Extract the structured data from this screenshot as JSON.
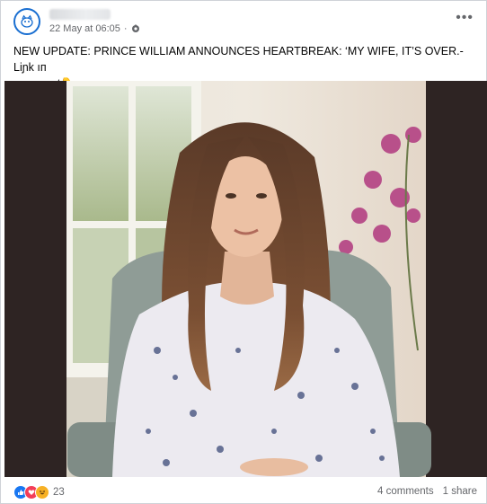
{
  "post": {
    "timestamp": "22 May at 06:05",
    "separator": "·",
    "caption_line1": "NEW UPDATE: PRINCE WILLIAM ANNOUNCES HEARTBREAK: ‘MY WIFE, IT’S OVER.- Liɲk ıп",
    "caption_line2": "cσmmeɲt👇"
  },
  "footer": {
    "reaction_count": "23",
    "comments": "4 comments",
    "shares": "1 share"
  },
  "colors": {
    "like_blue": "#1877f2",
    "love_red": "#f33e58",
    "haha_yellow": "#f7b125",
    "photo_backdrop": "#2e2423"
  },
  "icons": [
    "page-logo-icon",
    "globe-icon",
    "more-options-icon",
    "like-reaction-icon",
    "love-reaction-icon",
    "haha-reaction-icon"
  ]
}
